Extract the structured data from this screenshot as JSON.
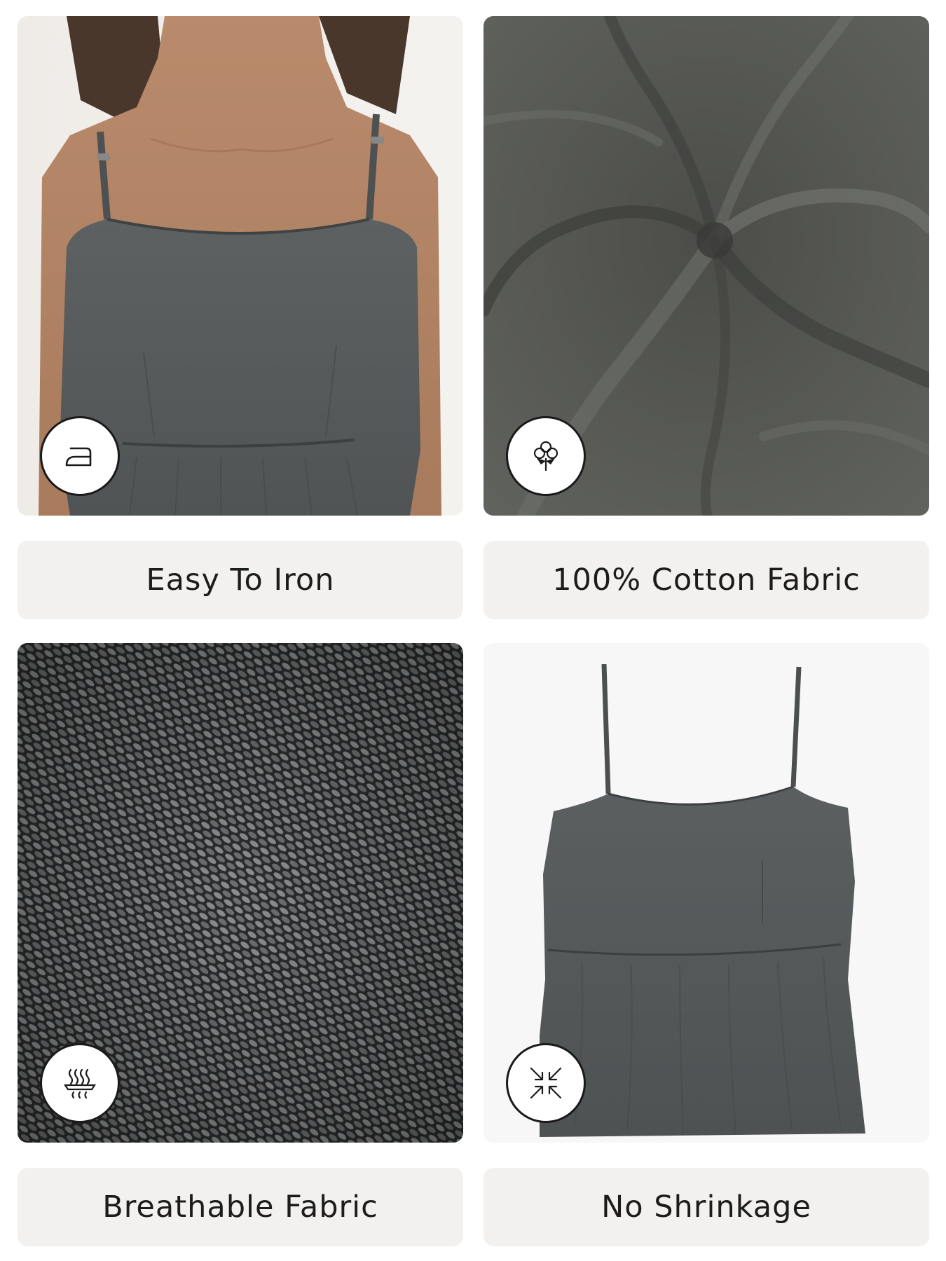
{
  "features": [
    {
      "label": "Easy To Iron",
      "icon": "iron-icon",
      "photo": "model-wearing-grey-cami-top"
    },
    {
      "label": "100% Cotton Fabric",
      "icon": "cotton-flower-icon",
      "photo": "grey-cotton-fabric-swirl"
    },
    {
      "label": "Breathable Fabric",
      "icon": "breathable-fabric-icon",
      "photo": "grey-fabric-weave-closeup"
    },
    {
      "label": "No Shrinkage",
      "icon": "no-shrinkage-arrows-icon",
      "photo": "grey-cami-top-flat-lay"
    }
  ],
  "colors": {
    "garment": "#55595a",
    "label_bg": "#f2f1ef",
    "text": "#1c1c1c"
  }
}
